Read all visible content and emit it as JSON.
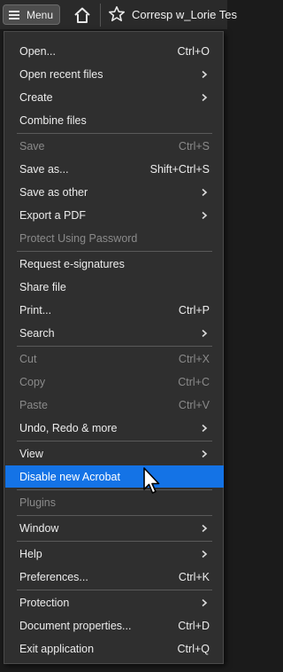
{
  "topbar": {
    "menu_label": "Menu",
    "doc_title": "Corresp w_Lorie Tes"
  },
  "menu": {
    "items": [
      {
        "label": "Open...",
        "shortcut": "Ctrl+O",
        "disabled": false
      },
      {
        "label": "Open recent files",
        "submenu": true,
        "disabled": false
      },
      {
        "label": "Create",
        "submenu": true,
        "disabled": false
      },
      {
        "label": "Combine files",
        "disabled": false
      },
      {
        "label": "Save",
        "shortcut": "Ctrl+S",
        "disabled": true
      },
      {
        "label": "Save as...",
        "shortcut": "Shift+Ctrl+S",
        "disabled": false
      },
      {
        "label": "Save as other",
        "submenu": true,
        "disabled": false
      },
      {
        "label": "Export a PDF",
        "submenu": true,
        "disabled": false
      },
      {
        "label": "Protect Using Password",
        "disabled": true
      },
      {
        "label": "Request e-signatures",
        "disabled": false
      },
      {
        "label": "Share file",
        "disabled": false
      },
      {
        "label": "Print...",
        "shortcut": "Ctrl+P",
        "disabled": false
      },
      {
        "label": "Search",
        "submenu": true,
        "disabled": false
      },
      {
        "label": "Cut",
        "shortcut": "Ctrl+X",
        "disabled": true
      },
      {
        "label": "Copy",
        "shortcut": "Ctrl+C",
        "disabled": true
      },
      {
        "label": "Paste",
        "shortcut": "Ctrl+V",
        "disabled": true
      },
      {
        "label": "Undo, Redo & more",
        "submenu": true,
        "disabled": false
      },
      {
        "label": "View",
        "submenu": true,
        "disabled": false
      },
      {
        "label": "Disable new Acrobat",
        "highlighted": true,
        "disabled": false
      },
      {
        "label": "Plugins",
        "disabled": true
      },
      {
        "label": "Window",
        "submenu": true,
        "disabled": false
      },
      {
        "label": "Help",
        "submenu": true,
        "disabled": false
      },
      {
        "label": "Preferences...",
        "shortcut": "Ctrl+K",
        "disabled": false
      },
      {
        "label": "Protection",
        "submenu": true,
        "disabled": false
      },
      {
        "label": "Document properties...",
        "shortcut": "Ctrl+D",
        "disabled": false
      },
      {
        "label": "Exit application",
        "shortcut": "Ctrl+Q",
        "disabled": false
      }
    ]
  },
  "colors": {
    "highlight": "#1473e6",
    "menu_bg": "#2f2f2f",
    "disabled_text": "#8a8a8a"
  }
}
